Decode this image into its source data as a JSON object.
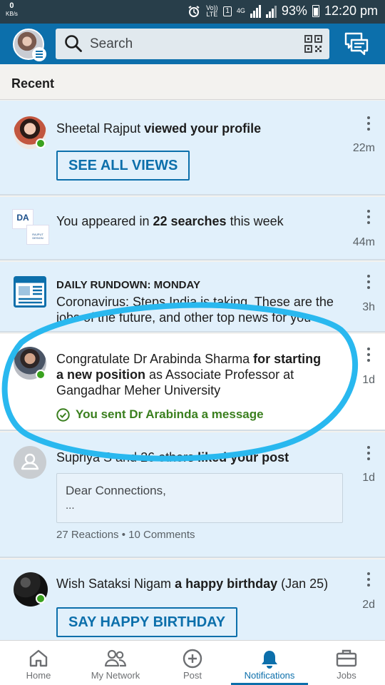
{
  "status_bar": {
    "speed_value": "0",
    "speed_unit": "KB/s",
    "volte": "Vo)) LTE",
    "sim": "1",
    "network": "4G",
    "battery": "93%",
    "time": "12:20 pm"
  },
  "header": {
    "search_placeholder": "Search"
  },
  "section_title": "Recent",
  "notifications": {
    "n1": {
      "name": "Sheetal Rajput",
      "action": "viewed your profile",
      "time": "22m",
      "button": "SEE ALL VIEWS"
    },
    "n2": {
      "prefix": "You appeared in",
      "bold": "22 searches",
      "suffix": "this week",
      "time": "44m",
      "logo_text": "DA",
      "logo_sub": "RAJPUT DESIGN"
    },
    "n3": {
      "title": "DAILY RUNDOWN: MONDAY",
      "line1": "Coronavirus: Steps India is taking, These are the",
      "line2": "jobs of the future, and other top news for you",
      "time": "3h"
    },
    "n4": {
      "prefix": "Congratulate Dr Arabinda Sharma",
      "bold1": "for starting",
      "bold2": "a new position",
      "suffix": "as Associate Professor at",
      "line3": "Gangadhar Meher University",
      "sent": "You sent Dr Arabinda a message",
      "time": "1d"
    },
    "n5": {
      "prefix": "Supriya S and 26 others",
      "bold": "liked your post",
      "time": "1d",
      "post_line1": "Dear Connections,",
      "post_line2": "...",
      "stats": "27 Reactions • 10 Comments"
    },
    "n6": {
      "prefix": "Wish Sataksi Nigam",
      "bold": "a happy birthday",
      "suffix": "(Jan 25)",
      "time": "2d",
      "button": "SAY HAPPY BIRTHDAY"
    }
  },
  "bottom_nav": [
    {
      "label": "Home",
      "icon": "home-icon"
    },
    {
      "label": "My Network",
      "icon": "network-icon"
    },
    {
      "label": "Post",
      "icon": "post-icon"
    },
    {
      "label": "Notifications",
      "icon": "bell-icon",
      "active": true
    },
    {
      "label": "Jobs",
      "icon": "briefcase-icon"
    }
  ],
  "colors": {
    "brand": "#0c6fab",
    "unread_bg": "#e1f0fb",
    "success": "#3aa21f",
    "annotation": "#29b8ef"
  }
}
